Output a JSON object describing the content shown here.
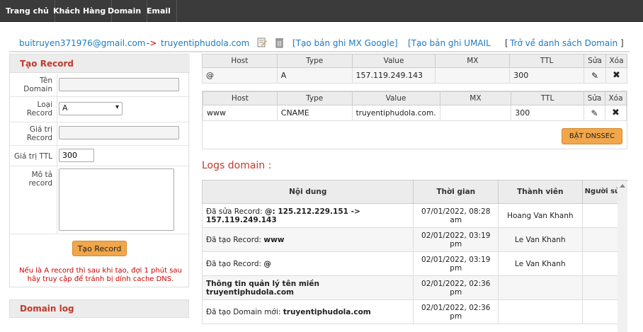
{
  "nav": {
    "items": [
      "Trang chủ",
      "Khách Hàng",
      "Domain",
      "Email"
    ]
  },
  "header": {
    "email": "buitruyen371976@gmail.com",
    "arrow": "->",
    "domain": "truyentiphudola.com",
    "link_mx_google": "[Tạo bản ghi MX Google]",
    "link_umail": "[Tạo bản ghi UMAIL",
    "link_back_open": "[",
    "link_back": "Trở về danh sách Domain",
    "link_back_close": "]"
  },
  "create_record": {
    "title": "Tạo Record",
    "fields": {
      "name_label": "Tên Domain",
      "name_value": "",
      "type_label": "Loại Record",
      "type_value": "A",
      "value_label": "Giá trị Record",
      "value_value": "",
      "ttl_label": "Giá trị TTL",
      "ttl_value": "300",
      "desc_label": "Mô tả record",
      "desc_value": ""
    },
    "submit_label": "Tạo Record",
    "note": "Nếu là A record thì sau khi tạo, đợi 1 phút sau hãy truy cập để tránh bị dính cache DNS."
  },
  "domain_log_panel": {
    "title": "Domain log"
  },
  "dns_headers": [
    "Host",
    "Type",
    "Value",
    "MX",
    "TTL",
    "Sửa",
    "Xóa"
  ],
  "dns_records": [
    {
      "host": "@",
      "type": "A",
      "value": "157.119.249.143",
      "mx": "",
      "ttl": "300"
    },
    {
      "host": "www",
      "type": "CNAME",
      "value": "truyentiphudola.com.",
      "mx": "",
      "ttl": "300"
    }
  ],
  "dnssec_button": "BẬT DNSSEC",
  "logs": {
    "title": "Logs domain :",
    "headers": [
      "Nội dung",
      "Thời gian",
      "Thành viên",
      "Người sửa"
    ],
    "rows": [
      {
        "prefix": "Đã sửa Record: ",
        "bold": "@: 125.212.229.151 -> 157.119.249.143",
        "time": "07/01/2022, 08:28 am",
        "member": "Hoang Van Khanh",
        "editor": ""
      },
      {
        "prefix": "Đã tạo Record: ",
        "bold": "www",
        "time": "02/01/2022, 03:19 pm",
        "member": "Le Van Khanh",
        "editor": ""
      },
      {
        "prefix": "Đã tạo Record: ",
        "bold": "@",
        "time": "02/01/2022, 03:19 pm",
        "member": "Le Van Khanh",
        "editor": ""
      },
      {
        "prefix": "",
        "bold": "Thông tin quản lý tên miền truyentiphudola.com",
        "time": "02/01/2022, 02:36 pm",
        "member": "",
        "editor": ""
      },
      {
        "prefix": "Đã tạo Domain mới: ",
        "bold": "truyentiphudola.com",
        "time": "02/01/2022, 02:36 pm",
        "member": "",
        "editor": ""
      }
    ]
  },
  "colors": {
    "accent_red": "#c0392b",
    "link_blue": "#1d7bbf",
    "button_orange": "#f0a64a",
    "nav_bg": "#3b3b3b"
  }
}
